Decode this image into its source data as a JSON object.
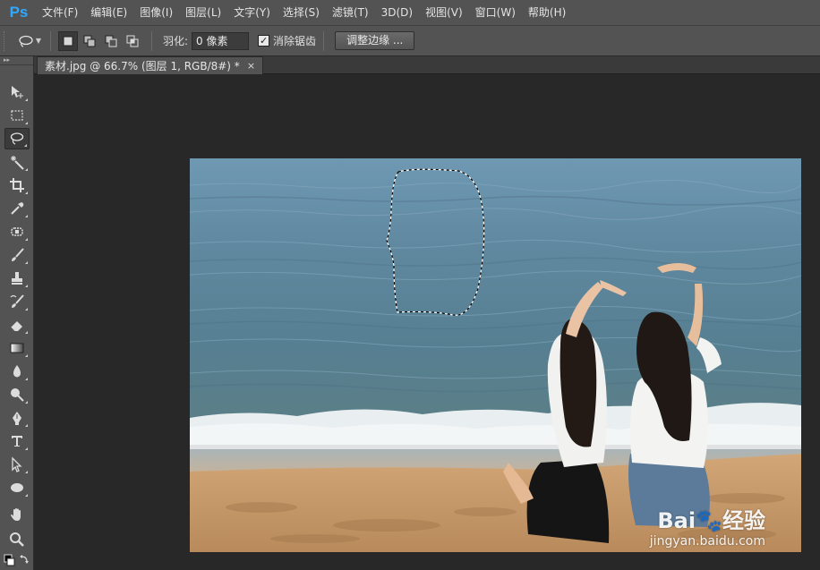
{
  "app": {
    "logo": "Ps"
  },
  "menu": [
    "文件(F)",
    "编辑(E)",
    "图像(I)",
    "图层(L)",
    "文字(Y)",
    "选择(S)",
    "滤镜(T)",
    "3D(D)",
    "视图(V)",
    "窗口(W)",
    "帮助(H)"
  ],
  "options": {
    "feather_label": "羽化:",
    "feather_value": "0 像素",
    "antialias_label": "消除锯齿",
    "antialias_checked": true,
    "refine_edge_label": "调整边缘 ..."
  },
  "tools": [
    {
      "name": "move-tool-icon"
    },
    {
      "name": "marquee-tool-icon"
    },
    {
      "name": "lasso-tool-icon",
      "active": true
    },
    {
      "name": "magic-wand-tool-icon"
    },
    {
      "name": "crop-tool-icon"
    },
    {
      "name": "eyedropper-tool-icon"
    },
    {
      "name": "healing-brush-tool-icon"
    },
    {
      "name": "brush-tool-icon"
    },
    {
      "name": "clone-stamp-tool-icon"
    },
    {
      "name": "history-brush-tool-icon"
    },
    {
      "name": "eraser-tool-icon"
    },
    {
      "name": "gradient-tool-icon"
    },
    {
      "name": "blur-tool-icon"
    },
    {
      "name": "dodge-tool-icon"
    },
    {
      "name": "pen-tool-icon"
    },
    {
      "name": "type-tool-icon"
    },
    {
      "name": "path-selection-tool-icon"
    },
    {
      "name": "ellipse-tool-icon"
    },
    {
      "name": "hand-tool-icon"
    },
    {
      "name": "zoom-tool-icon"
    }
  ],
  "document": {
    "tab_title": "素材.jpg @ 66.7% (图层 1, RGB/8#) *",
    "close_glyph": "×"
  },
  "watermark": {
    "brand": "Bai🐾经验",
    "url": "jingyan.baidu.com"
  },
  "colors": {
    "ps_blue": "#31a8ff",
    "panel": "#535353",
    "workspace": "#282828"
  }
}
